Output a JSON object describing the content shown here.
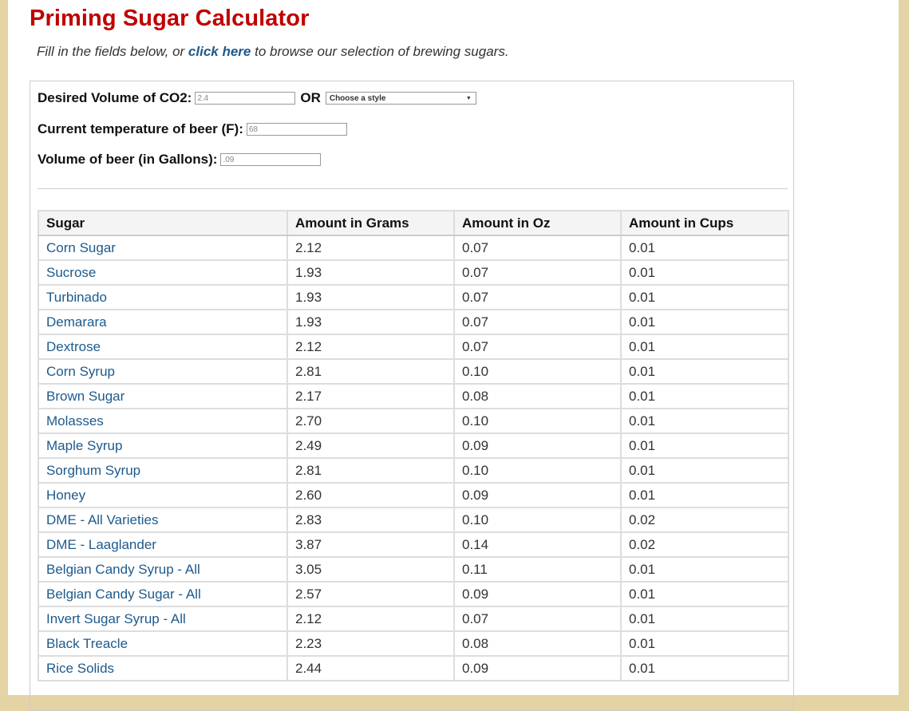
{
  "title": "Priming Sugar Calculator",
  "intro": {
    "before": "Fill in the fields below, or ",
    "link": "click here",
    "after": " to browse our selection of brewing sugars."
  },
  "form": {
    "co2_label": "Desired Volume of CO2:",
    "co2_value": "2.4",
    "or_label": "OR",
    "style_select": "Choose a style",
    "temp_label": "Current temperature of beer (F):",
    "temp_value": "68",
    "volume_label": "Volume of beer (in Gallons):",
    "volume_value": ".09"
  },
  "table": {
    "headers": [
      "Sugar",
      "Amount in Grams",
      "Amount in Oz",
      "Amount in Cups"
    ],
    "rows": [
      [
        "Corn Sugar",
        "2.12",
        "0.07",
        "0.01"
      ],
      [
        "Sucrose",
        "1.93",
        "0.07",
        "0.01"
      ],
      [
        "Turbinado",
        "1.93",
        "0.07",
        "0.01"
      ],
      [
        "Demarara",
        "1.93",
        "0.07",
        "0.01"
      ],
      [
        "Dextrose",
        "2.12",
        "0.07",
        "0.01"
      ],
      [
        "Corn Syrup",
        "2.81",
        "0.10",
        "0.01"
      ],
      [
        "Brown Sugar",
        "2.17",
        "0.08",
        "0.01"
      ],
      [
        "Molasses",
        "2.70",
        "0.10",
        "0.01"
      ],
      [
        "Maple Syrup",
        "2.49",
        "0.09",
        "0.01"
      ],
      [
        "Sorghum Syrup",
        "2.81",
        "0.10",
        "0.01"
      ],
      [
        "Honey",
        "2.60",
        "0.09",
        "0.01"
      ],
      [
        "DME - All Varieties",
        "2.83",
        "0.10",
        "0.02"
      ],
      [
        "DME - Laaglander",
        "3.87",
        "0.14",
        "0.02"
      ],
      [
        "Belgian Candy Syrup - All",
        "3.05",
        "0.11",
        "0.01"
      ],
      [
        "Belgian Candy Sugar - All",
        "2.57",
        "0.09",
        "0.01"
      ],
      [
        "Invert Sugar Syrup - All",
        "2.12",
        "0.07",
        "0.01"
      ],
      [
        "Black Treacle",
        "2.23",
        "0.08",
        "0.01"
      ],
      [
        "Rice Solids",
        "2.44",
        "0.09",
        "0.01"
      ]
    ]
  }
}
